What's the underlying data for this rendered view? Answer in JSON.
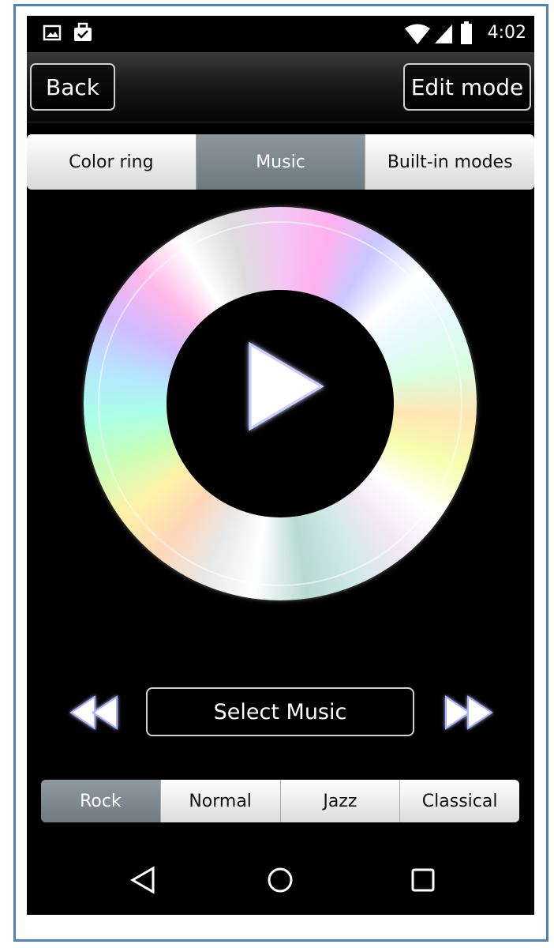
{
  "status_bar": {
    "time": "4:02",
    "icons": [
      "image-icon",
      "briefcase-check-icon",
      "wifi-icon",
      "signal-icon",
      "battery-icon"
    ]
  },
  "action_bar": {
    "back_label": "Back",
    "edit_label": "Edit mode"
  },
  "tabs": [
    {
      "label": "Color ring",
      "active": false
    },
    {
      "label": "Music",
      "active": true
    },
    {
      "label": "Built-in modes",
      "active": false
    }
  ],
  "player": {
    "select_music_label": "Select Music",
    "icons": [
      "play-icon",
      "rewind-icon",
      "fast-forward-icon"
    ]
  },
  "genres": [
    {
      "label": "Rock",
      "active": true
    },
    {
      "label": "Normal",
      "active": false
    },
    {
      "label": "Jazz",
      "active": false
    },
    {
      "label": "Classical",
      "active": false
    }
  ],
  "nav_bar": {
    "icons": [
      "back-triangle-icon",
      "home-circle-icon",
      "recents-square-icon"
    ]
  },
  "colors": {
    "frame_border": "#4f7fc1",
    "active_tab": "#7d898e",
    "background": "#000000"
  }
}
